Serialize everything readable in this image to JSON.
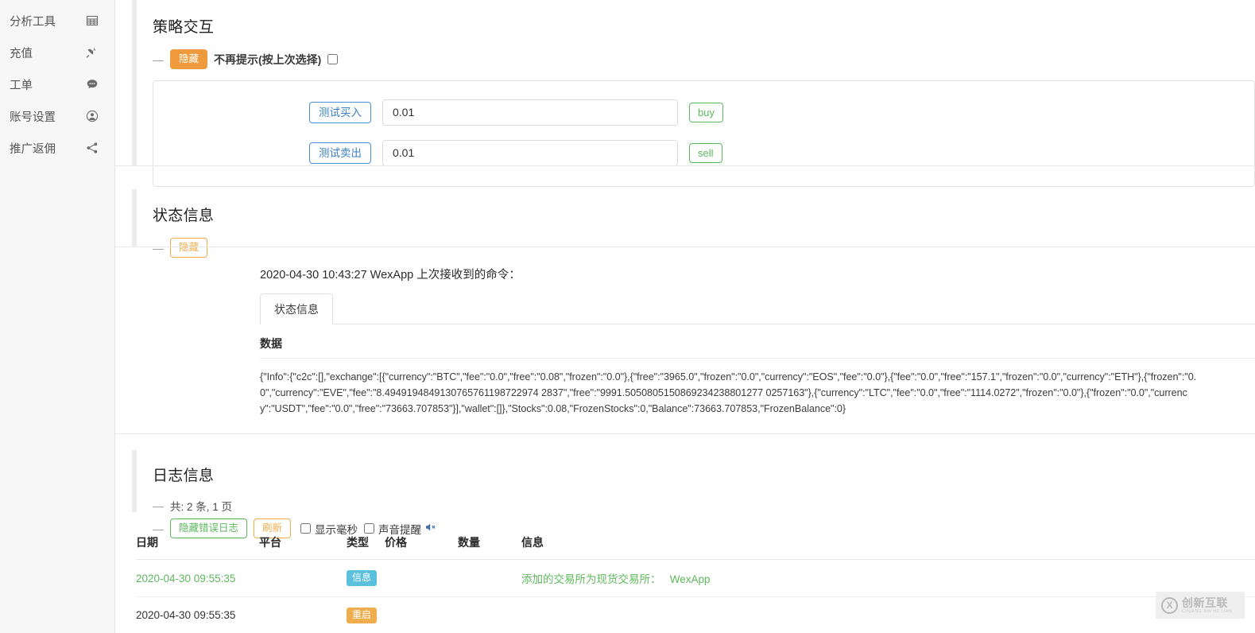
{
  "sidebar": {
    "items": [
      {
        "label": "分析工具",
        "icon": "grid-table-icon"
      },
      {
        "label": "充值",
        "icon": "plug-icon"
      },
      {
        "label": "工单",
        "icon": "comment-icon"
      },
      {
        "label": "账号设置",
        "icon": "user-circle-icon"
      },
      {
        "label": "推广返佣",
        "icon": "share-icon"
      }
    ]
  },
  "strategy_interaction": {
    "title": "策略交互",
    "dash": "—",
    "hide_button": "隐藏",
    "no_prompt_label": "不再提示(按上次选择)",
    "rows": [
      {
        "action_label": "测试买入",
        "value": "0.01",
        "side_label": "buy"
      },
      {
        "action_label": "测试卖出",
        "value": "0.01",
        "side_label": "sell"
      }
    ]
  },
  "status_section": {
    "title": "状态信息",
    "dash": "—",
    "hide_button": "隐藏",
    "last_command_line": "2020-04-30 10:43:27 WexApp 上次接收到的命令：",
    "tabs": [
      {
        "label": "状态信息",
        "active": true
      }
    ],
    "data_label": "数据",
    "json_payload": "{\"Info\":{\"c2c\":[],\"exchange\":[{\"currency\":\"BTC\",\"fee\":\"0.0\",\"free\":\"0.08\",\"frozen\":\"0.0\"},{\"free\":\"3965.0\",\"frozen\":\"0.0\",\"currency\":\"EOS\",\"fee\":\"0.0\"},{\"fee\":\"0.0\",\"free\":\"157.1\",\"frozen\":\"0.0\",\"currency\":\"ETH\"},{\"frozen\":\"0.0\",\"currency\":\"EVE\",\"fee\":\"8.4949194849130765761198722974 2837\",\"free\":\"9991.5050805150869234238801277 0257163\"},{\"currency\":\"LTC\",\"fee\":\"0.0\",\"free\":\"1114.0272\",\"frozen\":\"0.0\"},{\"frozen\":\"0.0\",\"currency\":\"USDT\",\"fee\":\"0.0\",\"free\":\"73663.707853\"}],\"wallet\":[]},\"Stocks\":0.08,\"FrozenStocks\":0,\"Balance\":73663.707853,\"FrozenBalance\":0}"
  },
  "log_section": {
    "title": "日志信息",
    "dash": "—",
    "count_line": "共: 2 条, 1 页",
    "hide_error_button": "隐藏错误日志",
    "refresh_button": "刷新",
    "show_ms_label": "显示毫秒",
    "sound_label": "声音提醒",
    "sound_icon": "speaker-mute-icon",
    "columns": [
      "日期",
      "平台",
      "类型",
      "价格",
      "数量",
      "信息"
    ],
    "rows": [
      {
        "date": "2020-04-30 09:55:35",
        "platform": "",
        "type_badge": "信息",
        "type_badge_color": "#5bc0de",
        "price": "",
        "amount": "",
        "info": "添加的交易所为现货交易所：   WexApp",
        "row_color": "#5cb85c"
      },
      {
        "date": "2020-04-30 09:55:35",
        "platform": "",
        "type_badge": "重启",
        "type_badge_color": "#f0ad4e",
        "price": "",
        "amount": "",
        "info": "",
        "row_color": "#333333"
      }
    ]
  },
  "watermark": {
    "mark": "X",
    "cn": "创新互联",
    "en": "CHUANG XIN HU LIAN"
  },
  "colors": {
    "accent_orange": "#f0ad4e",
    "accent_orange_solid": "#ef9a3d",
    "success_green": "#5cb85c",
    "info_blue": "#5bc0de",
    "link_blue": "#3b82c4",
    "sidebar_bg": "#f7f7f7"
  }
}
